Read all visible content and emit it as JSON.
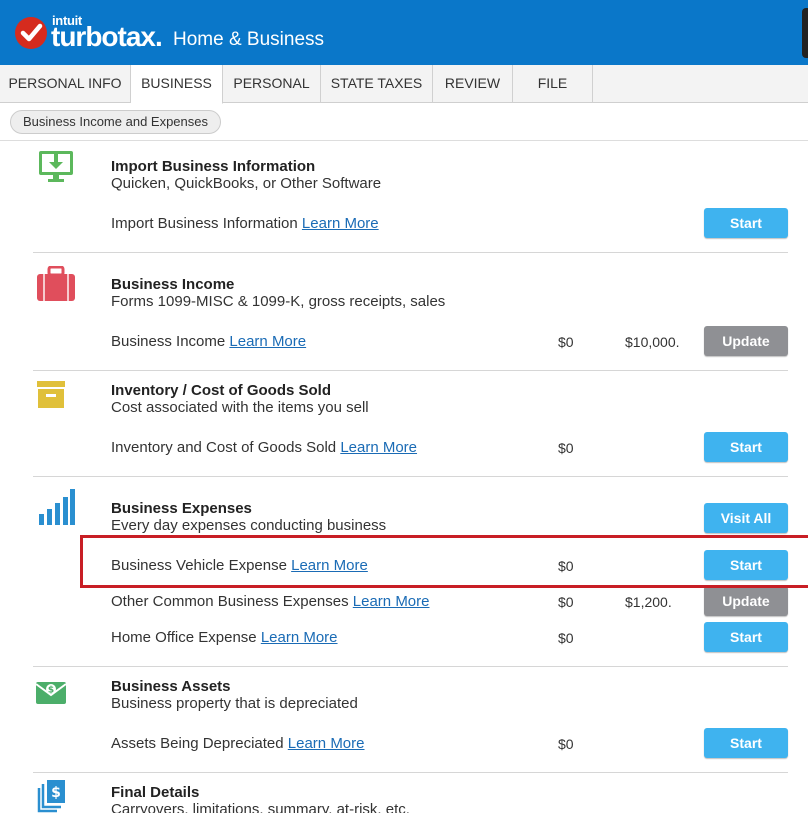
{
  "header": {
    "brand_intuit": "intuit",
    "brand_name": "turbotax.",
    "brand_product": "Home & Business"
  },
  "tabs": [
    {
      "label": "PERSONAL INFO",
      "active": false
    },
    {
      "label": "BUSINESS",
      "active": true
    },
    {
      "label": "PERSONAL",
      "active": false
    },
    {
      "label": "STATE TAXES",
      "active": false
    },
    {
      "label": "REVIEW",
      "active": false
    },
    {
      "label": "FILE",
      "active": false
    }
  ],
  "breadcrumb": "Business Income and Expenses",
  "learn_more": "Learn More",
  "sections": {
    "import": {
      "icon": "download-monitor-icon",
      "title": "Import Business Information",
      "subtitle": "Quicken, QuickBooks, or Other Software",
      "rows": [
        {
          "label": "Import Business Information",
          "button": "Start"
        }
      ]
    },
    "income": {
      "icon": "briefcase-icon",
      "title": "Business Income",
      "subtitle": "Forms 1099-MISC & 1099-K, gross receipts, sales",
      "rows": [
        {
          "label": "Business Income",
          "amount1": "$0",
          "amount2": "$10,000.",
          "button": "Update"
        }
      ]
    },
    "inventory": {
      "icon": "box-icon",
      "title": "Inventory / Cost of Goods Sold",
      "subtitle": "Cost associated with the items you sell",
      "rows": [
        {
          "label": "Inventory and Cost of Goods Sold",
          "amount1": "$0",
          "button": "Start"
        }
      ]
    },
    "expenses": {
      "icon": "bar-chart-icon",
      "title": "Business Expenses",
      "subtitle": "Every day expenses conducting business",
      "visit_all": "Visit All",
      "rows": [
        {
          "label": "Business Vehicle Expense",
          "amount1": "$0",
          "button": "Start"
        },
        {
          "label": "Other Common Business Expenses",
          "amount1": "$0",
          "amount2": "$1,200.",
          "button": "Update"
        },
        {
          "label": "Home Office Expense",
          "amount1": "$0",
          "button": "Start"
        }
      ]
    },
    "assets": {
      "icon": "money-envelope-icon",
      "title": "Business Assets",
      "subtitle": "Business property that is depreciated",
      "rows": [
        {
          "label": "Assets Being Depreciated",
          "amount1": "$0",
          "button": "Start"
        }
      ]
    },
    "final": {
      "icon": "dollar-documents-icon",
      "title": "Final Details",
      "subtitle": "Carryovers, limitations, summary, at-risk, etc."
    }
  },
  "colors": {
    "header_blue": "#0a77c9",
    "start_button": "#3fb3ef",
    "update_button": "#8f9094",
    "highlight_red": "#c81e25",
    "link": "#1a6bb5"
  }
}
